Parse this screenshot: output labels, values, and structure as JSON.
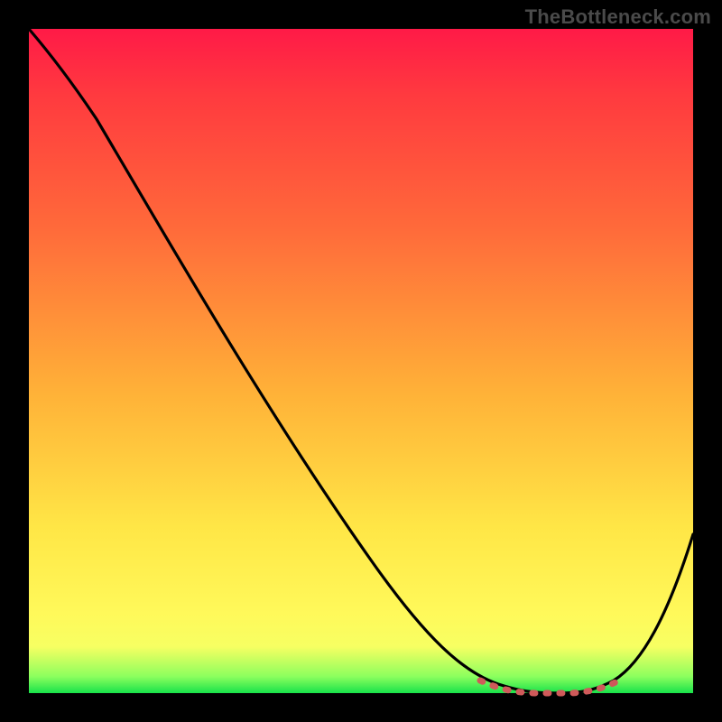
{
  "watermark": "TheBottleneck.com",
  "colors": {
    "background": "#000000",
    "curve": "#000000",
    "highlight": "#cf5a5a",
    "gradient_top": "#ff1a47",
    "gradient_mid": "#ffe646",
    "gradient_bottom": "#18e24a"
  },
  "chart_data": {
    "type": "line",
    "title": "",
    "xlabel": "",
    "ylabel": "",
    "xlim": [
      0,
      100
    ],
    "ylim": [
      0,
      100
    ],
    "series": [
      {
        "name": "bottleneck-curve",
        "x": [
          0,
          5,
          10,
          20,
          30,
          40,
          50,
          60,
          68,
          72,
          76,
          80,
          84,
          88,
          92,
          96,
          100
        ],
        "values": [
          100,
          96,
          91,
          78,
          64,
          50,
          36,
          22,
          10,
          4,
          1,
          0,
          0,
          1,
          6,
          15,
          28
        ]
      }
    ],
    "annotations": [
      {
        "name": "optimal-band",
        "x_start": 70,
        "x_end": 88,
        "style": "dashed-red-on-baseline"
      }
    ]
  }
}
